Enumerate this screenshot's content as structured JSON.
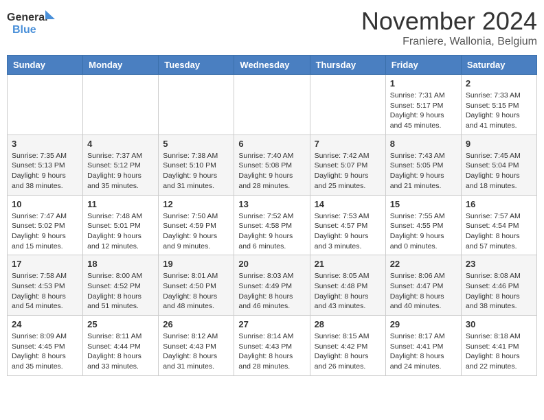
{
  "logo": {
    "text_general": "General",
    "text_blue": "Blue"
  },
  "title": "November 2024",
  "subtitle": "Franiere, Wallonia, Belgium",
  "days_of_week": [
    "Sunday",
    "Monday",
    "Tuesday",
    "Wednesday",
    "Thursday",
    "Friday",
    "Saturday"
  ],
  "weeks": [
    [
      {
        "day": "",
        "info": ""
      },
      {
        "day": "",
        "info": ""
      },
      {
        "day": "",
        "info": ""
      },
      {
        "day": "",
        "info": ""
      },
      {
        "day": "",
        "info": ""
      },
      {
        "day": "1",
        "info": "Sunrise: 7:31 AM\nSunset: 5:17 PM\nDaylight: 9 hours\nand 45 minutes."
      },
      {
        "day": "2",
        "info": "Sunrise: 7:33 AM\nSunset: 5:15 PM\nDaylight: 9 hours\nand 41 minutes."
      }
    ],
    [
      {
        "day": "3",
        "info": "Sunrise: 7:35 AM\nSunset: 5:13 PM\nDaylight: 9 hours\nand 38 minutes."
      },
      {
        "day": "4",
        "info": "Sunrise: 7:37 AM\nSunset: 5:12 PM\nDaylight: 9 hours\nand 35 minutes."
      },
      {
        "day": "5",
        "info": "Sunrise: 7:38 AM\nSunset: 5:10 PM\nDaylight: 9 hours\nand 31 minutes."
      },
      {
        "day": "6",
        "info": "Sunrise: 7:40 AM\nSunset: 5:08 PM\nDaylight: 9 hours\nand 28 minutes."
      },
      {
        "day": "7",
        "info": "Sunrise: 7:42 AM\nSunset: 5:07 PM\nDaylight: 9 hours\nand 25 minutes."
      },
      {
        "day": "8",
        "info": "Sunrise: 7:43 AM\nSunset: 5:05 PM\nDaylight: 9 hours\nand 21 minutes."
      },
      {
        "day": "9",
        "info": "Sunrise: 7:45 AM\nSunset: 5:04 PM\nDaylight: 9 hours\nand 18 minutes."
      }
    ],
    [
      {
        "day": "10",
        "info": "Sunrise: 7:47 AM\nSunset: 5:02 PM\nDaylight: 9 hours\nand 15 minutes."
      },
      {
        "day": "11",
        "info": "Sunrise: 7:48 AM\nSunset: 5:01 PM\nDaylight: 9 hours\nand 12 minutes."
      },
      {
        "day": "12",
        "info": "Sunrise: 7:50 AM\nSunset: 4:59 PM\nDaylight: 9 hours\nand 9 minutes."
      },
      {
        "day": "13",
        "info": "Sunrise: 7:52 AM\nSunset: 4:58 PM\nDaylight: 9 hours\nand 6 minutes."
      },
      {
        "day": "14",
        "info": "Sunrise: 7:53 AM\nSunset: 4:57 PM\nDaylight: 9 hours\nand 3 minutes."
      },
      {
        "day": "15",
        "info": "Sunrise: 7:55 AM\nSunset: 4:55 PM\nDaylight: 9 hours\nand 0 minutes."
      },
      {
        "day": "16",
        "info": "Sunrise: 7:57 AM\nSunset: 4:54 PM\nDaylight: 8 hours\nand 57 minutes."
      }
    ],
    [
      {
        "day": "17",
        "info": "Sunrise: 7:58 AM\nSunset: 4:53 PM\nDaylight: 8 hours\nand 54 minutes."
      },
      {
        "day": "18",
        "info": "Sunrise: 8:00 AM\nSunset: 4:52 PM\nDaylight: 8 hours\nand 51 minutes."
      },
      {
        "day": "19",
        "info": "Sunrise: 8:01 AM\nSunset: 4:50 PM\nDaylight: 8 hours\nand 48 minutes."
      },
      {
        "day": "20",
        "info": "Sunrise: 8:03 AM\nSunset: 4:49 PM\nDaylight: 8 hours\nand 46 minutes."
      },
      {
        "day": "21",
        "info": "Sunrise: 8:05 AM\nSunset: 4:48 PM\nDaylight: 8 hours\nand 43 minutes."
      },
      {
        "day": "22",
        "info": "Sunrise: 8:06 AM\nSunset: 4:47 PM\nDaylight: 8 hours\nand 40 minutes."
      },
      {
        "day": "23",
        "info": "Sunrise: 8:08 AM\nSunset: 4:46 PM\nDaylight: 8 hours\nand 38 minutes."
      }
    ],
    [
      {
        "day": "24",
        "info": "Sunrise: 8:09 AM\nSunset: 4:45 PM\nDaylight: 8 hours\nand 35 minutes."
      },
      {
        "day": "25",
        "info": "Sunrise: 8:11 AM\nSunset: 4:44 PM\nDaylight: 8 hours\nand 33 minutes."
      },
      {
        "day": "26",
        "info": "Sunrise: 8:12 AM\nSunset: 4:43 PM\nDaylight: 8 hours\nand 31 minutes."
      },
      {
        "day": "27",
        "info": "Sunrise: 8:14 AM\nSunset: 4:43 PM\nDaylight: 8 hours\nand 28 minutes."
      },
      {
        "day": "28",
        "info": "Sunrise: 8:15 AM\nSunset: 4:42 PM\nDaylight: 8 hours\nand 26 minutes."
      },
      {
        "day": "29",
        "info": "Sunrise: 8:17 AM\nSunset: 4:41 PM\nDaylight: 8 hours\nand 24 minutes."
      },
      {
        "day": "30",
        "info": "Sunrise: 8:18 AM\nSunset: 4:41 PM\nDaylight: 8 hours\nand 22 minutes."
      }
    ]
  ]
}
